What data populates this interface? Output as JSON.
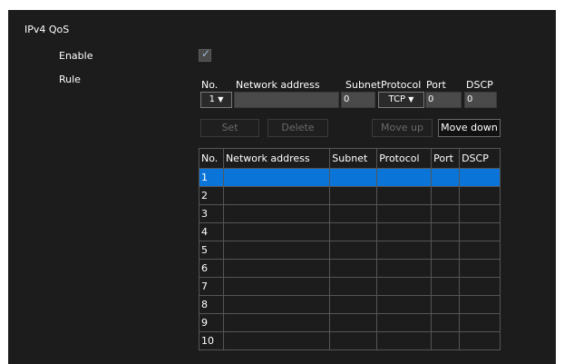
{
  "section": {
    "title": "IPv4 QoS"
  },
  "enable": {
    "label": "Enable",
    "checked": true,
    "check_glyph": "✓"
  },
  "rule": {
    "label": "Rule",
    "headers": {
      "no": "No.",
      "network_address": "Network address",
      "subnet": "Subnet",
      "protocol": "Protocol",
      "port": "Port",
      "dscp": "DSCP"
    },
    "values": {
      "no": "1",
      "network_address": "",
      "subnet": "0",
      "protocol": "TCP",
      "port": "0",
      "dscp": "0"
    },
    "arrow": "▼"
  },
  "buttons": {
    "set": "Set",
    "delete": "Delete",
    "move_up": "Move up",
    "move_down": "Move down"
  },
  "table": {
    "columns": [
      "No.",
      "Network address",
      "Subnet",
      "Protocol",
      "Port",
      "DSCP"
    ],
    "rows": [
      "1",
      "2",
      "3",
      "4",
      "5",
      "6",
      "7",
      "8",
      "9",
      "10"
    ],
    "selected_row": "1"
  },
  "colors": {
    "panel_bg": "#1c1c1c",
    "selected_row": "#0a74d8",
    "border": "#555555"
  }
}
